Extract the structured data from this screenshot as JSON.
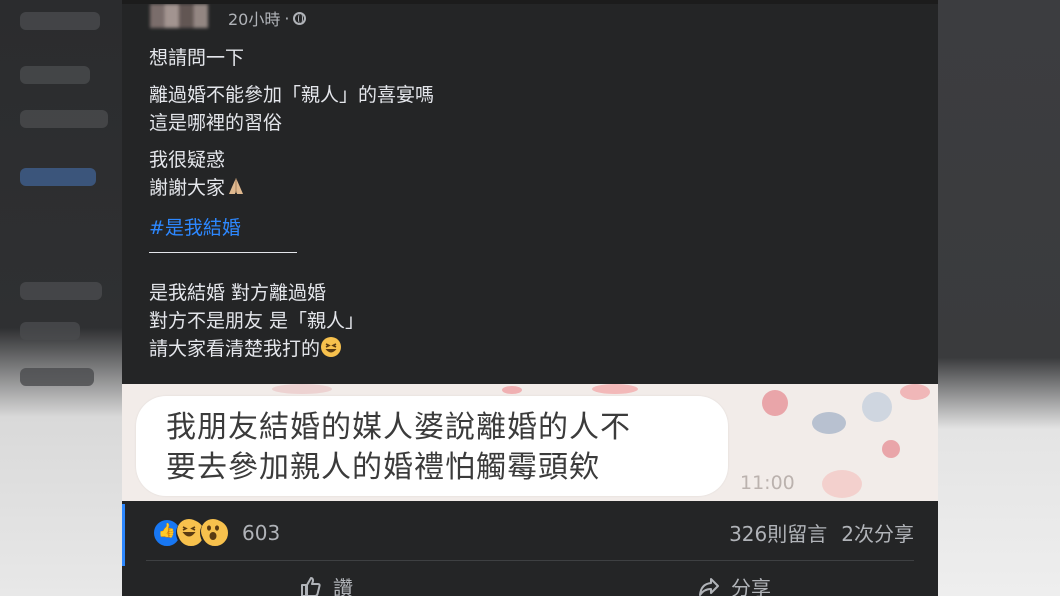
{
  "post": {
    "timestamp": "20小時",
    "separator": "·",
    "lines": [
      "想請問一下",
      "離過婚不能參加「親人」的喜宴嗎",
      "這是哪裡的習俗",
      "我很疑惑",
      "謝謝大家",
      "#是我結婚",
      "是我結婚 對方離過婚",
      "對方不是朋友 是「親人」",
      "請大家看清楚我打的"
    ],
    "hashtag": "#是我結婚"
  },
  "chat_image": {
    "message_line1": "我朋友結婚的媒人婆說離婚的人不",
    "message_line2": "要去參加親人的婚禮怕觸霉頭欸",
    "time": "11:00"
  },
  "engagement": {
    "reaction_icons": [
      "like-icon",
      "haha-icon",
      "wow-icon"
    ],
    "reaction_count": "603",
    "comments": "326則留言",
    "shares": "2次分享"
  },
  "actions": {
    "like_label": "讚",
    "share_label": "分享"
  },
  "colors": {
    "card_bg": "#242526",
    "text": "#e4e6eb",
    "muted": "#b0b3b8",
    "link": "#2d88ff",
    "like_blue": "#1877f2"
  }
}
